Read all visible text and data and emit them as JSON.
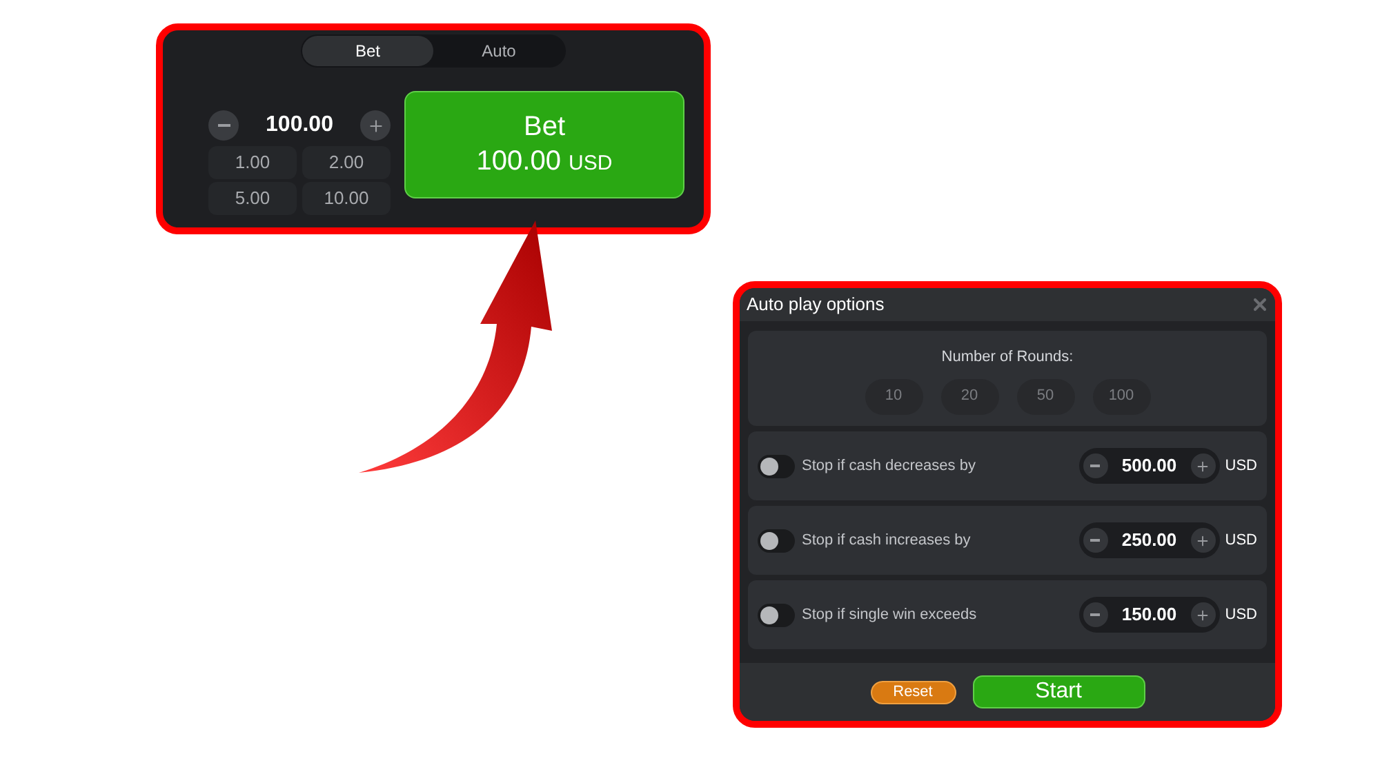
{
  "bet_panel": {
    "tabs": [
      {
        "label": "Bet",
        "selected": true
      },
      {
        "label": "Auto",
        "selected": false
      }
    ],
    "amount": "100.00",
    "quick_amounts": [
      "1.00",
      "2.00",
      "5.00",
      "10.00"
    ],
    "bet_button": {
      "label": "Bet",
      "amount": "100.00",
      "currency": "USD"
    }
  },
  "autoplay_dialog": {
    "title": "Auto play options",
    "rounds": {
      "label": "Number of Rounds:",
      "options": [
        {
          "label": "10",
          "selected": false
        },
        {
          "label": "20",
          "selected": false
        },
        {
          "label": "50",
          "selected": false
        },
        {
          "label": "100",
          "selected": false
        }
      ]
    },
    "stop_rules": [
      {
        "label": "Stop if cash decreases by",
        "on": false,
        "value": "500.00",
        "currency": "USD"
      },
      {
        "label": "Stop if cash increases by",
        "on": false,
        "value": "250.00",
        "currency": "USD"
      },
      {
        "label": "Stop if single win exceeds",
        "on": false,
        "value": "150.00",
        "currency": "USD"
      }
    ],
    "reset_button": "Reset",
    "start_button": "Start"
  }
}
